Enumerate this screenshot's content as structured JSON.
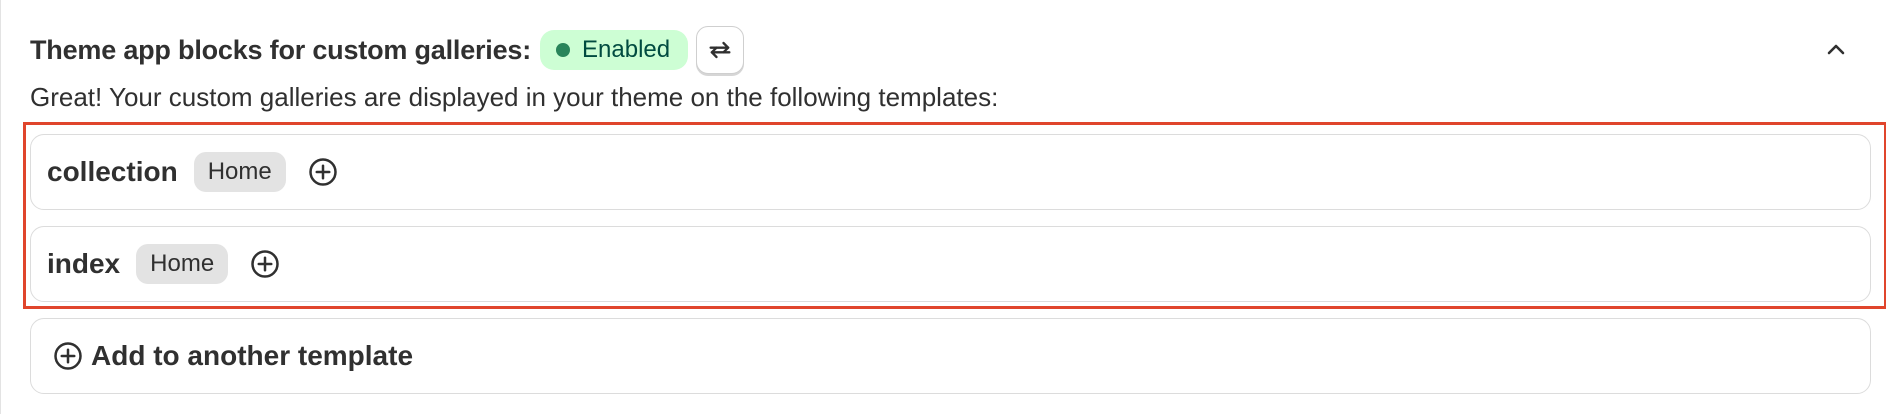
{
  "section": {
    "title": "Theme app blocks for custom galleries:",
    "status_label": "Enabled",
    "status_color": "#cdfed4",
    "status_dot_color": "#29845a",
    "sync_icon": "sync-icon",
    "collapse_icon": "chevron-up-icon",
    "description": "Great! Your custom galleries are displayed in your theme on the following templates:"
  },
  "templates": [
    {
      "name": "collection",
      "tag": "Home",
      "add_icon": "plus-circle-icon"
    },
    {
      "name": "index",
      "tag": "Home",
      "add_icon": "plus-circle-icon"
    }
  ],
  "add_template": {
    "label": "Add to another template",
    "icon": "plus-circle-icon"
  },
  "highlight_color": "#e0452c"
}
